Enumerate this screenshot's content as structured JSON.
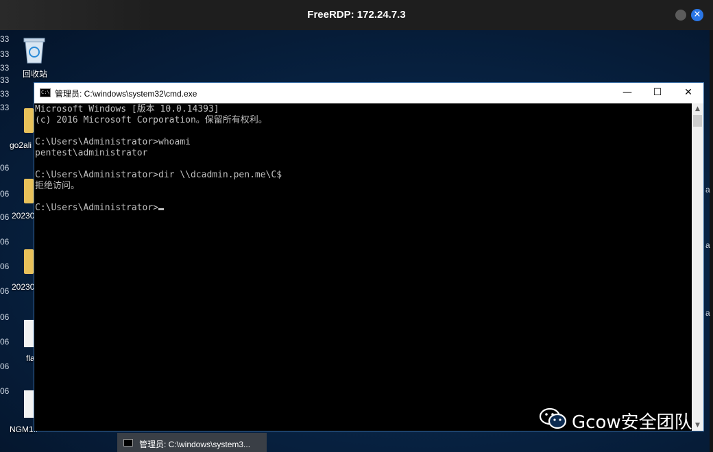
{
  "host_window": {
    "title": "FreeRDP: 172.24.7.3"
  },
  "desktop": {
    "icons": [
      {
        "label": "回收站"
      },
      {
        "label": "go2ali"
      },
      {
        "label": "20230"
      },
      {
        "label": "20230"
      },
      {
        "label": "fla"
      },
      {
        "label": "NGM1..."
      }
    ],
    "left_edge_fragments": [
      "33",
      "33",
      "33",
      "33",
      "33",
      "33",
      "06",
      "06",
      "06",
      "06",
      "06",
      "06",
      "06",
      "06",
      "06",
      "06"
    ],
    "right_edge_fragments": [
      "a",
      "a",
      "a"
    ]
  },
  "cmd_window": {
    "title": "管理员: C:\\windows\\system32\\cmd.exe",
    "controls": {
      "minimize": "—",
      "maximize": "☐",
      "close": "✕"
    },
    "console_lines": [
      "Microsoft Windows [版本 10.0.14393]",
      "(c) 2016 Microsoft Corporation。保留所有权利。",
      "",
      "C:\\Users\\Administrator>whoami",
      "pentest\\administrator",
      "",
      "C:\\Users\\Administrator>dir \\\\dcadmin.pen.me\\C$",
      "拒绝访问。",
      ""
    ],
    "prompt": "C:\\Users\\Administrator>"
  },
  "taskbar": {
    "item_label": "管理员: C:\\windows\\system3..."
  },
  "watermark": {
    "text": "Gcow安全团队"
  }
}
